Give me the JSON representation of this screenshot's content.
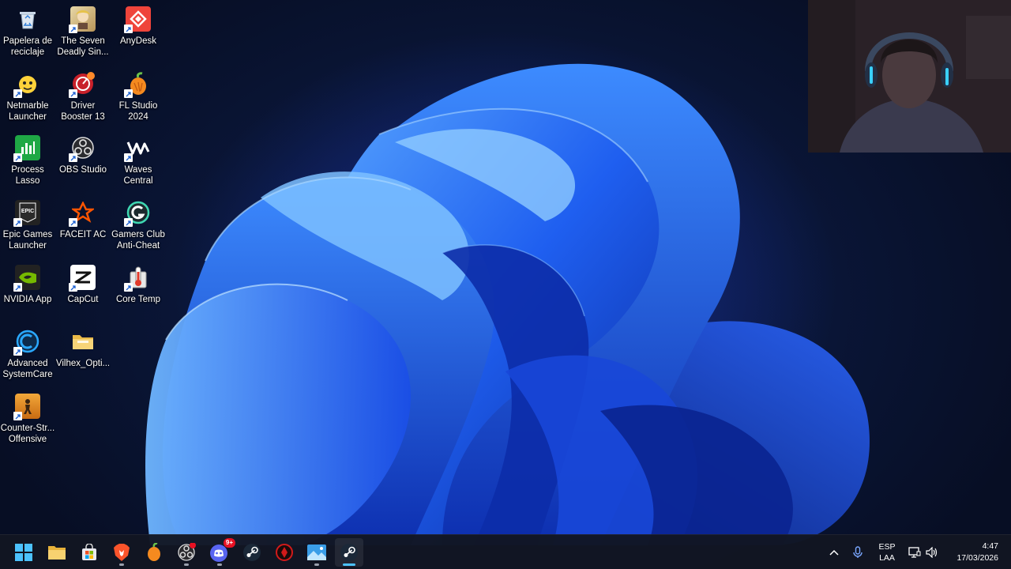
{
  "desktop": {
    "icons": [
      {
        "label": "Papelera de\nreciclaje",
        "icon": "recycle-bin-icon"
      },
      {
        "label": "The Seven\nDeadly Sin...",
        "icon": "game-icon"
      },
      {
        "label": "AnyDesk",
        "icon": "anydesk-icon"
      },
      {
        "label": "Netmarble\nLauncher",
        "icon": "netmarble-icon"
      },
      {
        "label": "Driver\nBooster 13",
        "icon": "driver-booster-icon"
      },
      {
        "label": "FL Studio\n2024",
        "icon": "fl-studio-icon"
      },
      {
        "label": "Process\nLasso",
        "icon": "process-lasso-icon"
      },
      {
        "label": "OBS Studio",
        "icon": "obs-icon"
      },
      {
        "label": "Waves\nCentral",
        "icon": "waves-icon"
      },
      {
        "label": "Epic Games\nLauncher",
        "icon": "epic-games-icon"
      },
      {
        "label": "FACEIT AC",
        "icon": "faceit-icon"
      },
      {
        "label": "Gamers Club\nAnti-Cheat",
        "icon": "gamers-club-icon"
      },
      {
        "label": "NVIDIA App",
        "icon": "nvidia-icon"
      },
      {
        "label": "CapCut",
        "icon": "capcut-icon"
      },
      {
        "label": "Core Temp",
        "icon": "core-temp-icon"
      },
      {
        "label": "Advanced\nSystemCare",
        "icon": "advanced-systemcare-icon"
      },
      {
        "label": "Vilhex_Opti...",
        "icon": "folder-icon"
      },
      {
        "label": "Counter-Str...\nOffensive",
        "icon": "counter-strike-icon"
      }
    ]
  },
  "taskbar": {
    "apps": [
      {
        "icon": "windows-start-icon"
      },
      {
        "icon": "file-explorer-icon"
      },
      {
        "icon": "microsoft-store-icon"
      },
      {
        "icon": "brave-browser-icon"
      },
      {
        "icon": "fl-studio-icon"
      },
      {
        "icon": "obs-icon"
      },
      {
        "icon": "discord-icon",
        "badge": "9+"
      },
      {
        "icon": "steam-icon"
      },
      {
        "icon": "app-red-icon"
      },
      {
        "icon": "photos-icon"
      },
      {
        "icon": "steam-icon"
      }
    ],
    "tray": {
      "language": "ESP",
      "layout": "LAA",
      "time": "4:47",
      "date": "17/03/2026"
    }
  },
  "colors": {
    "accent": "#4cc2ff",
    "taskbar_bg": "#121622",
    "wallpaper_blue": "#1d4fe0"
  }
}
